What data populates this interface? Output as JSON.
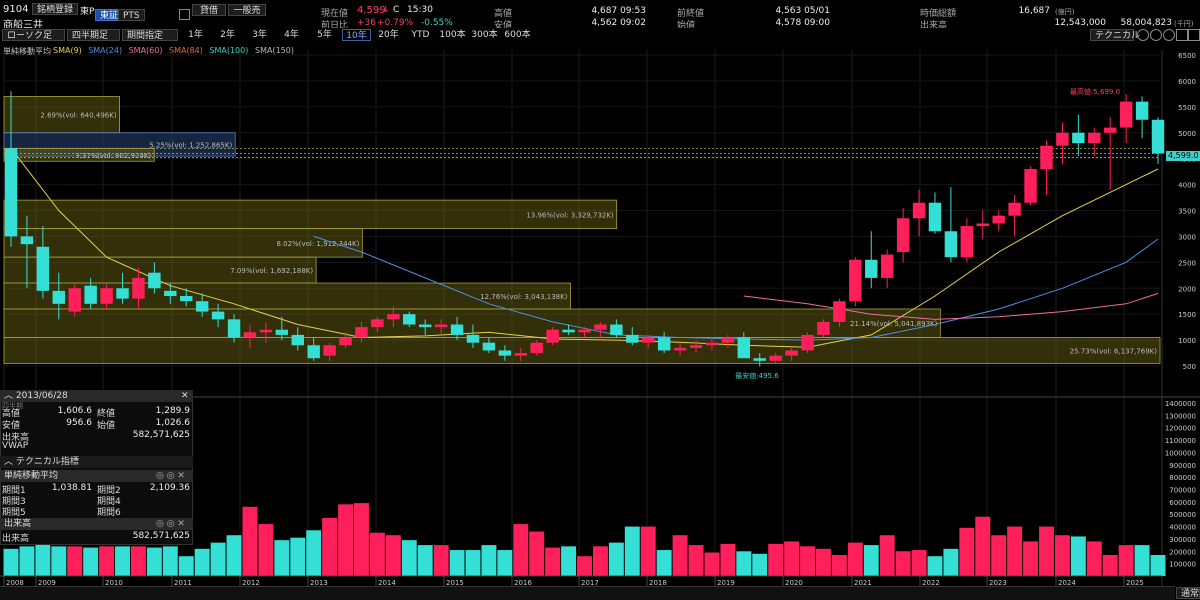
{
  "header": {
    "code": "9104",
    "name": "商船三井",
    "register_btn": "銘柄登録",
    "market": "東P",
    "tab_tse": "東証",
    "tab_pts": "PTS",
    "credit_btn": "貸借",
    "general_btn": "一般売",
    "current_label": "現在値",
    "current_value": "4,599",
    "current_mark": "↓",
    "c_mark": "C",
    "current_time": "15:30",
    "prev_diff_label": "前日比",
    "prev_diff": "+36",
    "prev_diff_pct": "+0.79%",
    "prev_diff_pct2": "-0.55%",
    "high_label": "高値",
    "high_value": "4,687 09:53",
    "low_label": "安値",
    "low_value": "4,562 09:02",
    "prevclose_label": "前終値",
    "prevclose_value": "4,563 05/01",
    "open_label": "始値",
    "open_value": "4,578 09:00",
    "mcap_label": "時価総額",
    "mcap_value": "16,687",
    "mcap_unit": "(億円)",
    "volume_label": "出来高",
    "volume_value": "12,543,000",
    "turnover_value": "58,004,823",
    "turnover_unit": "(千円)"
  },
  "toolbar": {
    "chart_type": "ローソク足",
    "period_type": "四半期足",
    "period_spec": "期間指定",
    "ranges": [
      "1年",
      "2年",
      "3年",
      "4年",
      "5年",
      "10年",
      "20年",
      "YTD",
      "100本",
      "300本",
      "600本"
    ],
    "active_range": "10年",
    "technical_btn": "テクニカル"
  },
  "legend": {
    "title": "単純移動平均",
    "items": [
      {
        "label": "SMA(9)",
        "color": "#e6d24a"
      },
      {
        "label": "SMA(24)",
        "color": "#4f8fe6"
      },
      {
        "label": "SMA(60)",
        "color": "#e86fa0"
      },
      {
        "label": "SMA(84)",
        "color": "#e06a4a"
      },
      {
        "label": "SMA(100)",
        "color": "#3fd1c8"
      },
      {
        "label": "SMA(150)",
        "color": "#bbbbbb"
      }
    ]
  },
  "info_panel": {
    "date": "2013/06/28",
    "sub": "四半期",
    "high_label": "高値",
    "high": "1,606.6",
    "close_label": "終値",
    "close": "1,289.9",
    "low_label": "安値",
    "low": "956.6",
    "open_label": "始値",
    "open": "1,026.6",
    "vol_label": "出来高",
    "vol": "582,571,625",
    "vwap_label": "VWAP",
    "tech_title": "テクニカル指標",
    "sma_title": "単純移動平均",
    "p1_label": "期間1",
    "p1": "1,038.81",
    "p2_label": "期間2",
    "p2": "2,109.36",
    "p3_label": "期間3",
    "p4_label": "期間4",
    "p5_label": "期間5",
    "p6_label": "期間6",
    "vol_title": "出来高",
    "vol2_label": "出来高",
    "vol2": "582,571,625"
  },
  "price_tag": "4,599.0",
  "footer_btn": "通常",
  "chart_data": {
    "type": "candlestick",
    "period": "quarterly",
    "y_range": [
      500,
      6500
    ],
    "y_ticks": [
      500,
      1000,
      1500,
      2000,
      2500,
      3000,
      3500,
      4000,
      4500,
      5000,
      5500,
      6000,
      6500
    ],
    "x_year_labels": [
      "2008",
      "2009",
      "2010",
      "2011",
      "2012",
      "2013",
      "2014",
      "2015",
      "2016",
      "2017",
      "2018",
      "2019",
      "2020",
      "2021",
      "2022",
      "2023",
      "2024",
      "2025"
    ],
    "max_label": "最高値:5,699.0",
    "min_label": "最安値:495.6",
    "candles": [
      [
        4700,
        5800,
        2800,
        3000
      ],
      [
        3000,
        3400,
        2000,
        2850
      ],
      [
        2800,
        3200,
        1800,
        1950
      ],
      [
        1950,
        2300,
        1400,
        1700
      ],
      [
        1550,
        2100,
        1450,
        2000
      ],
      [
        2050,
        2200,
        1600,
        1700
      ],
      [
        1700,
        2100,
        1600,
        2000
      ],
      [
        2000,
        2300,
        1700,
        1800
      ],
      [
        1800,
        2400,
        1600,
        2200
      ],
      [
        2300,
        2500,
        1900,
        2000
      ],
      [
        1950,
        2100,
        1700,
        1850
      ],
      [
        1850,
        2000,
        1650,
        1750
      ],
      [
        1750,
        1900,
        1450,
        1550
      ],
      [
        1550,
        1700,
        1250,
        1400
      ],
      [
        1400,
        1500,
        950,
        1050
      ],
      [
        1050,
        1300,
        850,
        1150
      ],
      [
        1150,
        1350,
        950,
        1200
      ],
      [
        1200,
        1450,
        1000,
        1100
      ],
      [
        1100,
        1250,
        800,
        900
      ],
      [
        900,
        1050,
        600,
        650
      ],
      [
        700,
        950,
        600,
        900
      ],
      [
        900,
        1150,
        850,
        1050
      ],
      [
        1050,
        1350,
        950,
        1250
      ],
      [
        1250,
        1450,
        1150,
        1400
      ],
      [
        1400,
        1650,
        1250,
        1500
      ],
      [
        1500,
        1550,
        1250,
        1300
      ],
      [
        1300,
        1400,
        1100,
        1250
      ],
      [
        1250,
        1400,
        1100,
        1300
      ],
      [
        1300,
        1450,
        1000,
        1100
      ],
      [
        1100,
        1300,
        850,
        950
      ],
      [
        950,
        1050,
        750,
        800
      ],
      [
        800,
        900,
        600,
        700
      ],
      [
        700,
        850,
        600,
        750
      ],
      [
        750,
        1000,
        700,
        950
      ],
      [
        950,
        1250,
        900,
        1200
      ],
      [
        1200,
        1300,
        1100,
        1150
      ],
      [
        1150,
        1250,
        1050,
        1200
      ],
      [
        1200,
        1350,
        1050,
        1300
      ],
      [
        1300,
        1400,
        1050,
        1100
      ],
      [
        1100,
        1250,
        900,
        950
      ],
      [
        950,
        1100,
        850,
        1050
      ],
      [
        1050,
        1150,
        750,
        800
      ],
      [
        800,
        950,
        700,
        850
      ],
      [
        850,
        1000,
        750,
        900
      ],
      [
        900,
        1050,
        800,
        950
      ],
      [
        950,
        1100,
        850,
        1050
      ],
      [
        1050,
        1150,
        700,
        650
      ],
      [
        650,
        750,
        495.6,
        600
      ],
      [
        600,
        750,
        550,
        700
      ],
      [
        700,
        850,
        600,
        800
      ],
      [
        800,
        1150,
        750,
        1100
      ],
      [
        1100,
        1400,
        1050,
        1350
      ],
      [
        1350,
        1800,
        1250,
        1750
      ],
      [
        1750,
        2600,
        1650,
        2550
      ],
      [
        2550,
        3100,
        2000,
        2200
      ],
      [
        2200,
        2750,
        2000,
        2650
      ],
      [
        2700,
        3550,
        2500,
        3350
      ],
      [
        3350,
        3900,
        3000,
        3650
      ],
      [
        3650,
        3850,
        3050,
        3100
      ],
      [
        3100,
        3950,
        2500,
        2600
      ],
      [
        2600,
        3350,
        2500,
        3200
      ],
      [
        3200,
        3500,
        2950,
        3250
      ],
      [
        3250,
        3500,
        3100,
        3400
      ],
      [
        3400,
        3800,
        3000,
        3650
      ],
      [
        3650,
        4350,
        3600,
        4300
      ],
      [
        4300,
        4850,
        3800,
        4750
      ],
      [
        4750,
        5200,
        4400,
        5000
      ],
      [
        5000,
        5350,
        4550,
        4800
      ],
      [
        4800,
        5100,
        4550,
        5000
      ],
      [
        5000,
        5300,
        3900,
        5100
      ],
      [
        5100,
        5750,
        4800,
        5600
      ],
      [
        5600,
        5699,
        4900,
        5250
      ],
      [
        5250,
        5300,
        4400,
        4599
      ]
    ],
    "sma_short": [
      [
        0,
        4700
      ],
      [
        3,
        3500
      ],
      [
        6,
        2600
      ],
      [
        10,
        2050
      ],
      [
        14,
        1700
      ],
      [
        18,
        1300
      ],
      [
        22,
        1050
      ],
      [
        26,
        1080
      ],
      [
        30,
        1150
      ],
      [
        34,
        1020
      ],
      [
        38,
        1000
      ],
      [
        42,
        960
      ],
      [
        46,
        900
      ],
      [
        50,
        860
      ],
      [
        54,
        1100
      ],
      [
        58,
        1850
      ],
      [
        62,
        2700
      ],
      [
        66,
        3400
      ],
      [
        70,
        4000
      ],
      [
        72,
        4300
      ]
    ],
    "sma_mid": [
      [
        19,
        3000
      ],
      [
        22,
        2700
      ],
      [
        26,
        2200
      ],
      [
        30,
        1700
      ],
      [
        34,
        1350
      ],
      [
        38,
        1100
      ],
      [
        42,
        1050
      ],
      [
        46,
        1020
      ],
      [
        50,
        1000
      ],
      [
        54,
        1050
      ],
      [
        58,
        1300
      ],
      [
        62,
        1600
      ],
      [
        66,
        2000
      ],
      [
        70,
        2500
      ],
      [
        72,
        2950
      ]
    ],
    "sma_long": [
      [
        46,
        1850
      ],
      [
        50,
        1700
      ],
      [
        54,
        1500
      ],
      [
        58,
        1400
      ],
      [
        62,
        1450
      ],
      [
        66,
        1550
      ],
      [
        70,
        1700
      ],
      [
        72,
        1900
      ]
    ],
    "volume_profile": [
      {
        "label": "2.69%(vol: 640,496K)",
        "low": 5000,
        "high": 5700,
        "width": 0.1
      },
      {
        "label": "5.25%(vol: 1,252,865K)",
        "low": 4550,
        "high": 5000,
        "width": 0.2
      },
      {
        "label": "3.37%(vol: 802,924K)",
        "low": 4450,
        "high": 4700,
        "width": 0.13
      },
      {
        "label": "13.96%(vol: 3,329,732K)",
        "low": 3150,
        "high": 3700,
        "width": 0.53
      },
      {
        "label": "8.02%(vol: 1,912,344K)",
        "low": 2600,
        "high": 3150,
        "width": 0.31
      },
      {
        "label": "7.09%(vol: 1,692,188K)",
        "low": 2100,
        "high": 2600,
        "width": 0.27
      },
      {
        "label": "12.76%(vol: 3,043,138K)",
        "low": 1600,
        "high": 2100,
        "width": 0.49
      },
      {
        "label": "21.14%(vol: 5,041,893K)",
        "low": 1050,
        "high": 1600,
        "width": 0.81
      },
      {
        "label": "25.73%(vol: 6,137,769K)",
        "low": 550,
        "high": 1050,
        "width": 1.0
      }
    ],
    "volume_y_range": [
      0,
      1400000
    ],
    "volume_y_ticks": [
      100000,
      200000,
      300000,
      400000,
      500000,
      600000,
      700000,
      800000,
      900000,
      1000000,
      1100000,
      1200000,
      1300000,
      1400000
    ],
    "volume": [
      220000,
      240000,
      260000,
      240000,
      240000,
      230000,
      240000,
      240000,
      240000,
      230000,
      240000,
      160000,
      220000,
      270000,
      330000,
      560000,
      420000,
      290000,
      310000,
      370000,
      470000,
      580000,
      590000,
      350000,
      330000,
      290000,
      250000,
      250000,
      210000,
      210000,
      250000,
      210000,
      420000,
      360000,
      230000,
      240000,
      160000,
      240000,
      270000,
      400000,
      400000,
      210000,
      330000,
      250000,
      190000,
      260000,
      200000,
      180000,
      260000,
      280000,
      240000,
      220000,
      170000,
      270000,
      250000,
      330000,
      200000,
      210000,
      160000,
      220000,
      390000,
      480000,
      330000,
      400000,
      280000,
      400000,
      330000,
      320000,
      280000,
      170000,
      250000,
      250000,
      170000
    ],
    "volume_full": [
      220000,
      240000,
      260000,
      240000,
      240000,
      230000,
      240000,
      240000,
      240000,
      230000,
      240000,
      160000,
      220000,
      270000,
      330000,
      560000,
      420000,
      290000,
      310000,
      370000,
      470000,
      580000,
      590000,
      350000,
      330000,
      290000,
      250000,
      250000,
      210000,
      210000,
      250000,
      210000,
      420000,
      360000,
      230000,
      240000,
      160000,
      240000,
      270000,
      400000,
      400000,
      210000,
      330000,
      250000,
      190000,
      260000,
      200000,
      180000,
      260000,
      280000,
      240000,
      220000,
      170000,
      270000,
      250000,
      330000,
      200000,
      210000,
      160000,
      220000,
      390000,
      480000,
      330000,
      400000,
      280000,
      400000,
      330000,
      320000,
      280000,
      170000,
      250000,
      250000,
      170000
    ]
  }
}
